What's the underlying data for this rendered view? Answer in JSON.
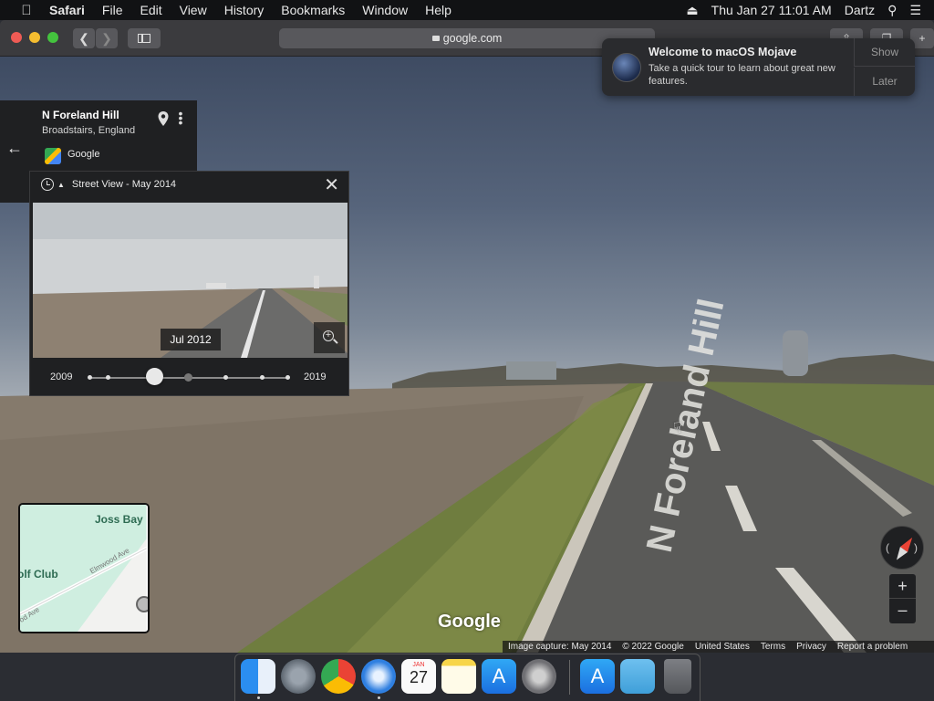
{
  "menubar": {
    "app": "Safari",
    "items": [
      "File",
      "Edit",
      "View",
      "History",
      "Bookmarks",
      "Window",
      "Help"
    ],
    "datetime": "Thu Jan 27  11:01 AM",
    "user": "Dartz"
  },
  "browser": {
    "url": "google.com"
  },
  "place": {
    "name": "N Foreland Hill",
    "location": "Broadstairs, England",
    "source": "Google"
  },
  "timemachine": {
    "title": "Street View - May 2014",
    "preview_date": "Jul 2012",
    "year_start": "2009",
    "year_end": "2019",
    "selected_fraction": 0.33
  },
  "notification": {
    "title": "Welcome to macOS Mojave",
    "body": "Take a quick tour to learn about great new features.",
    "show_label": "Show",
    "later_label": "Later"
  },
  "minimap": {
    "labels": {
      "poi1": "Joss Bay",
      "poi2": "olf Club",
      "road1": "Elmwood Ave",
      "road2": "od Ave"
    }
  },
  "scene": {
    "road_label": "N Foreland Hill",
    "watermark": "Google"
  },
  "footer": {
    "capture": "Image capture: May 2014",
    "copyright": "© 2022 Google",
    "region": "United States",
    "terms": "Terms",
    "privacy": "Privacy",
    "report": "Report a problem"
  },
  "colors": {
    "panel_bg": "#1f2022",
    "compass_red": "#ea4335",
    "map_green_text": "#2d6b52"
  },
  "dock": {
    "apps": [
      "finder-icon",
      "launchpad-icon",
      "chrome-icon",
      "safari-icon",
      "calendar-icon",
      "notes-icon",
      "app-store-icon",
      "system-preferences-icon",
      "app-store-icon",
      "downloads-folder-icon",
      "trash-icon"
    ],
    "calendar_month": "JAN",
    "calendar_day": "27"
  }
}
